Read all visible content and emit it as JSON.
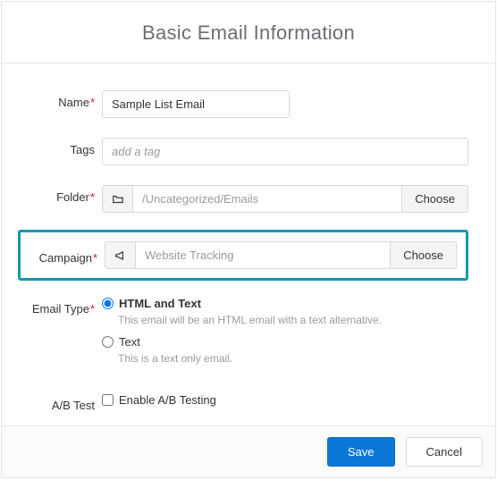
{
  "header": {
    "title": "Basic Email Information"
  },
  "fields": {
    "name": {
      "label": "Name",
      "value": "Sample List Email"
    },
    "tags": {
      "label": "Tags",
      "placeholder": "add a tag"
    },
    "folder": {
      "label": "Folder",
      "value": "/Uncategorized/Emails",
      "button": "Choose"
    },
    "campaign": {
      "label": "Campaign",
      "value": "Website Tracking",
      "button": "Choose"
    },
    "emailType": {
      "label": "Email Type",
      "options": [
        {
          "label": "HTML and Text",
          "desc": "This email will be an HTML email with a text alternative.",
          "checked": true
        },
        {
          "label": "Text",
          "desc": "This is a text only email.",
          "checked": false
        }
      ]
    },
    "abtest": {
      "label": "A/B Test",
      "checkbox": "Enable A/B Testing"
    }
  },
  "footer": {
    "save": "Save",
    "cancel": "Cancel"
  }
}
